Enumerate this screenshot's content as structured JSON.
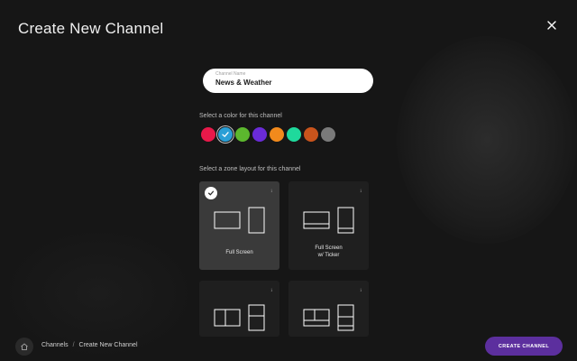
{
  "header": {
    "title": "Create New Channel",
    "close_icon": "close-icon"
  },
  "name_field": {
    "label": "Channel Name",
    "value": "News & Weather"
  },
  "color_section": {
    "label": "Select a color for this channel",
    "selected_index": 1,
    "swatches": [
      {
        "name": "red",
        "color": "#e8194a"
      },
      {
        "name": "blue",
        "color": "#2a9fd6"
      },
      {
        "name": "green",
        "color": "#5cb82e"
      },
      {
        "name": "purple",
        "color": "#6a2bd8"
      },
      {
        "name": "orange",
        "color": "#f28a1c"
      },
      {
        "name": "teal",
        "color": "#1fd99c"
      },
      {
        "name": "dark-orange",
        "color": "#c9541c"
      },
      {
        "name": "gray",
        "color": "#7a7a7a"
      }
    ]
  },
  "layout_section": {
    "label": "Select a zone layout for this channel",
    "selected_index": 0,
    "layouts": [
      {
        "id": "full-screen",
        "name_lines": [
          "Full Screen"
        ],
        "info_icon": "info-icon"
      },
      {
        "id": "full-screen-ticker",
        "name_lines": [
          "Full Screen",
          "w/ Ticker"
        ],
        "info_icon": "info-icon"
      },
      {
        "id": "split-left",
        "name_lines": [],
        "info_icon": "info-icon"
      },
      {
        "id": "split-bottom",
        "name_lines": [],
        "info_icon": "info-icon"
      }
    ]
  },
  "footer": {
    "home_icon": "home-icon",
    "breadcrumb": [
      "Channels",
      "Create New Channel"
    ],
    "separator": "/",
    "create_button_label": "CREATE CHANNEL"
  },
  "colors": {
    "background": "#161616",
    "accent": "#5c2f9e",
    "card_selected": "#3a3a3a",
    "card": "#1f1f1f"
  }
}
